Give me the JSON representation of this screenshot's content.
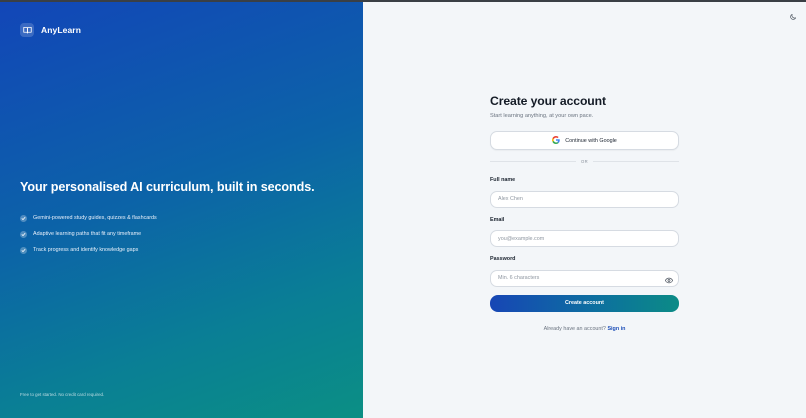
{
  "brand": {
    "name": "AnyLearn",
    "icon": "book-icon"
  },
  "hero": {
    "headline": "Your personalised AI curriculum, built in seconds.",
    "features": [
      "Gemini-powered study guides, quizzes & flashcards",
      "Adaptive learning paths that fit any timeframe",
      "Track progress and identify knowledge gaps"
    ],
    "footnote": "Free to get started. No credit card required."
  },
  "panel": {
    "theme_toggle_icon": "moon-icon",
    "title": "Create your account",
    "subtitle": "Start learning anything, at your own pace.",
    "google_button": "Continue with Google",
    "divider": "OR",
    "fields": {
      "full_name": {
        "label": "Full name",
        "value": "",
        "placeholder": "Alex Chen"
      },
      "email": {
        "label": "Email",
        "value": "",
        "placeholder": "you@example.com"
      },
      "password": {
        "label": "Password",
        "value": "",
        "placeholder": "Min. 6 characters"
      }
    },
    "submit": "Create account",
    "signin_prompt": "Already have an account?",
    "signin_link": "Sign in"
  },
  "colors": {
    "hero_gradient_start": "#1246b8",
    "hero_gradient_end": "#0b8f84",
    "panel_background": "#f3f6f9",
    "link": "#1d4fb8"
  }
}
